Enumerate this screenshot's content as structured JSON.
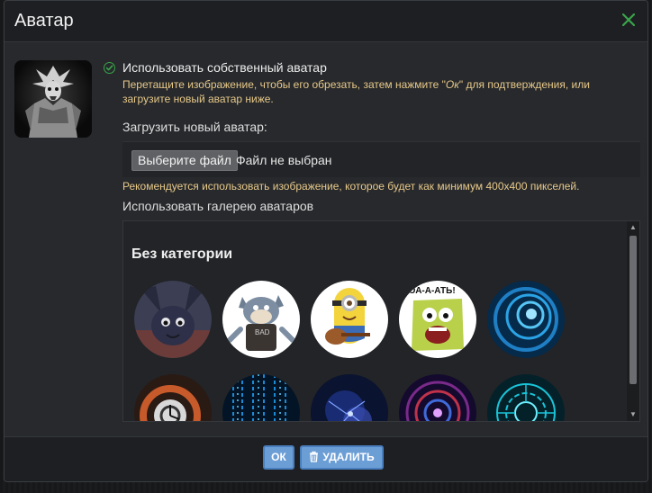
{
  "dialog": {
    "title": "Аватар",
    "close_icon": "close-icon"
  },
  "current_avatar": {
    "icon": "samurai-avatar-image"
  },
  "own_avatar_option": {
    "label": "Использовать собственный аватар",
    "hint_start": "Перетащите изображение, чтобы его обрезать, затем нажмите \"",
    "hint_ok": "Ок",
    "hint_end": "\" для подтверждения, или загрузите новый аватар ниже.",
    "selected": true,
    "accent_color": "#3aa54a"
  },
  "upload": {
    "label": "Загрузить новый аватар:",
    "button_label": "Выберите файл",
    "status": "Файл не выбран",
    "recommendation": "Рекомендуется использовать изображение, которое будет как минимум 400x400 пикселей."
  },
  "gallery": {
    "label": "Использовать галерею аватаров",
    "category_title": "Без категории",
    "avatars": [
      "bat-creature-avatar",
      "tom-cat-avatar",
      "minion-guitar-avatar",
      "spongebob-meme-avatar",
      "blue-spiral-avatar",
      "clock-gears-avatar",
      "blue-matrix-avatar",
      "blue-nebula-avatar",
      "purple-tunnel-avatar",
      "cyan-circuit-avatar"
    ],
    "meme_text": "ЕОА-А-АТЬ!"
  },
  "footer": {
    "ok_label": "ОК",
    "delete_label": "УДАЛИТЬ",
    "delete_icon": "trash-icon",
    "button_color": "#6c9ed6"
  }
}
